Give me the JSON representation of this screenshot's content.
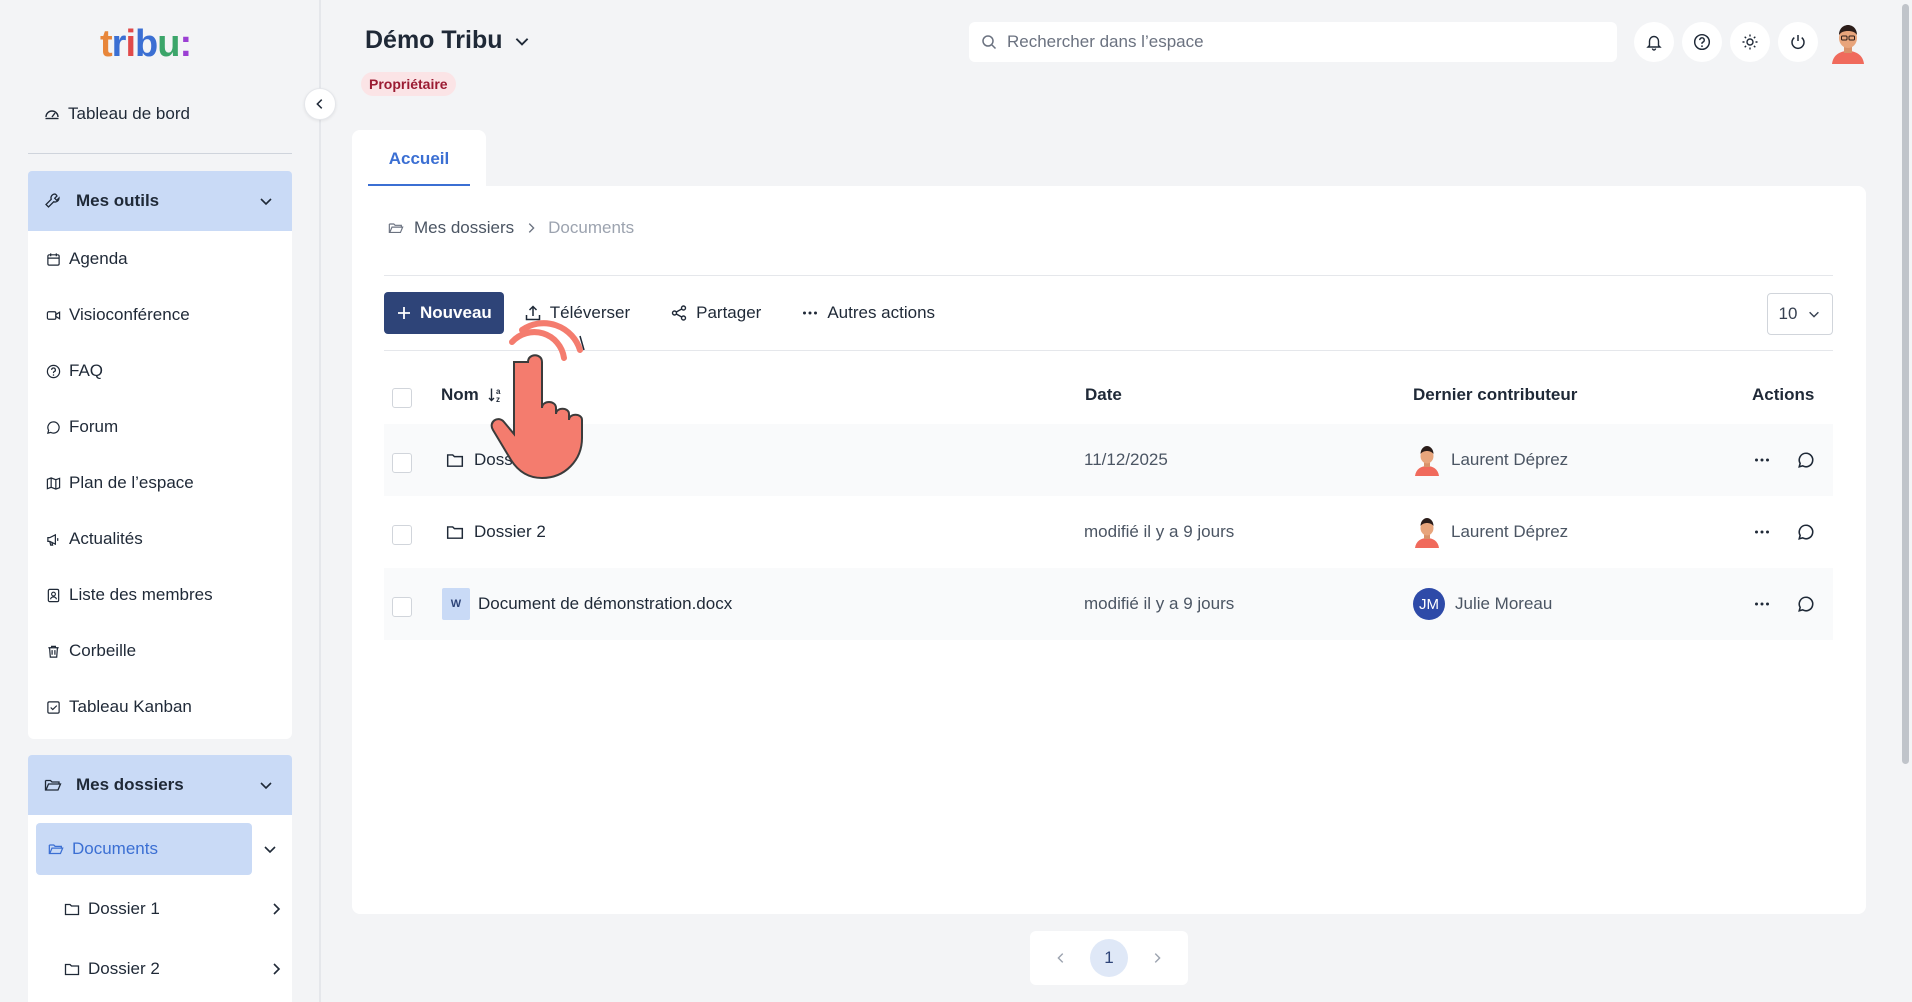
{
  "logo": {
    "text": "tribu:"
  },
  "sidebar": {
    "dashboard_label": "Tableau de bord",
    "tools_group_label": "Mes outils",
    "tools": [
      {
        "label": "Agenda",
        "icon": "calendar-icon"
      },
      {
        "label": "Visioconférence",
        "icon": "video-icon"
      },
      {
        "label": "FAQ",
        "icon": "help-circle-icon"
      },
      {
        "label": "Forum",
        "icon": "chat-icon"
      },
      {
        "label": "Plan de l’espace",
        "icon": "map-icon"
      },
      {
        "label": "Actualités",
        "icon": "megaphone-icon"
      },
      {
        "label": "Liste des membres",
        "icon": "contacts-icon"
      },
      {
        "label": "Corbeille",
        "icon": "trash-icon"
      },
      {
        "label": "Tableau Kanban",
        "icon": "checkbox-icon"
      }
    ],
    "folders_group_label": "Mes dossiers",
    "current_folder": "Documents",
    "subfolders": [
      "Dossier 1",
      "Dossier 2"
    ]
  },
  "header": {
    "space_title": "Démo Tribu",
    "role_badge": "Propriétaire",
    "search_placeholder": "Rechercher dans l’espace"
  },
  "tabs": [
    {
      "label": "Accueil",
      "active": true
    }
  ],
  "breadcrumb": {
    "root": "Mes dossiers",
    "current": "Documents"
  },
  "toolbar": {
    "new_label": "Nouveau",
    "upload_label": "Téléverser",
    "share_label": "Partager",
    "more_label": "Autres actions",
    "per_page": "10"
  },
  "table": {
    "headers": {
      "name": "Nom",
      "date": "Date",
      "contributor": "Dernier contributeur",
      "actions": "Actions"
    },
    "rows": [
      {
        "name": "Dossier 1",
        "name_visible": "Dossie",
        "type": "folder",
        "date": "11/12/2025",
        "contributor": "Laurent Déprez",
        "avatar": "avatar-illustration"
      },
      {
        "name": "Dossier 2",
        "type": "folder",
        "date": "modifié il y a 9 jours",
        "contributor": "Laurent Déprez",
        "avatar": "avatar-illustration"
      },
      {
        "name": "Document de démonstration.docx",
        "type": "docx",
        "file_icon_letter": "W",
        "date": "modifié il y a 9 jours",
        "contributor": "Julie Moreau",
        "initials": "JM"
      }
    ]
  },
  "pagination": {
    "current": "1"
  },
  "colors": {
    "primary": "#2e4478",
    "accent": "#3b6fd3",
    "sidebar_highlight": "#c9daf6",
    "badge_bg": "#fbe4e6",
    "badge_text": "#9b1c33",
    "cursor_hand": "#f47c6e"
  }
}
